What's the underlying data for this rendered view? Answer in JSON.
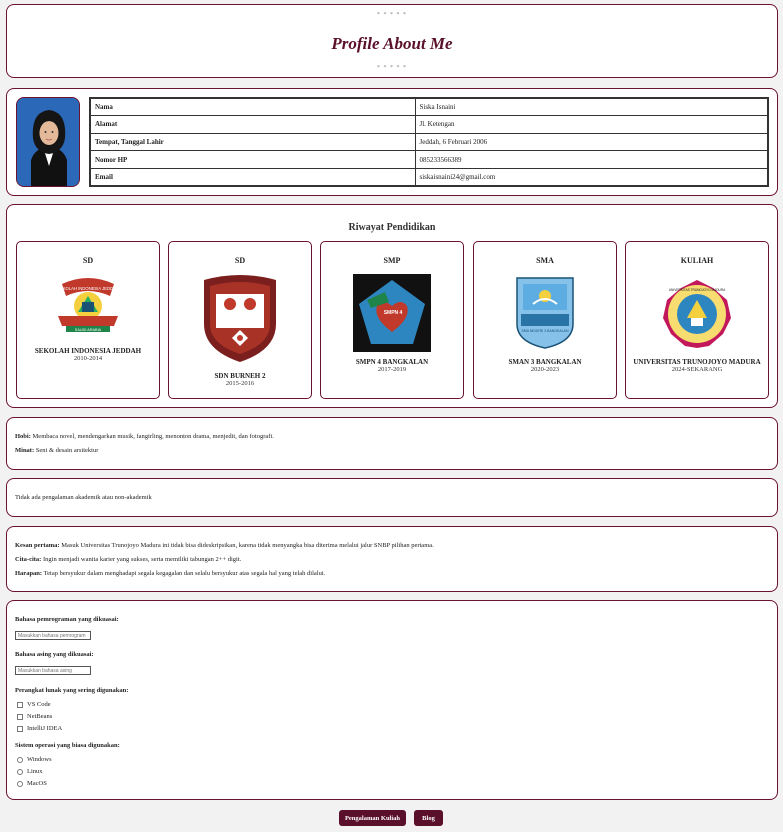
{
  "header": {
    "stars_top": "* * * * *",
    "title": "Profile About Me",
    "stars_bottom": "* * * * *"
  },
  "profile": {
    "rows": [
      {
        "key": "Nama",
        "value": "Siska Isnaini"
      },
      {
        "key": "Alamat",
        "value": "Jl. Ketengan"
      },
      {
        "key": "Tempat, Tanggal Lahir",
        "value": "Jeddah, 6 Februari 2006"
      },
      {
        "key": "Nomor HP",
        "value": "085233566389"
      },
      {
        "key": "Email",
        "value": "siskaisnaini24@gmail.com"
      }
    ]
  },
  "education": {
    "title": "Riwayat Pendidikan",
    "schools": [
      {
        "level": "SD",
        "name": "SEKOLAH INDONESIA JEDDAH",
        "years": "2010-2014",
        "logo": "sij-logo",
        "logo_text": "SEKOLAH INDONESIA JEDDAH",
        "logo_sub": "SAUDI ARABIA"
      },
      {
        "level": "SD",
        "name": "SDN BURNEH 2",
        "years": "2015-2016",
        "logo": "tut-wuri-logo"
      },
      {
        "level": "SMP",
        "name": "SMPN 4 BANGKALAN",
        "years": "2017-2019",
        "logo": "smpn4-logo",
        "logo_text": "SMPN 4"
      },
      {
        "level": "SMA",
        "name": "SMAN 3 BANGKALAN",
        "years": "2020-2023",
        "logo": "sman3-logo",
        "logo_text": "SMA NEGERI 3 BANGKALAN"
      },
      {
        "level": "KULIAH",
        "name": "UNIVERSITAS TRUNOJOYO MADURA",
        "years": "2024-SEKARANG",
        "logo": "utm-logo",
        "logo_text": "UNIVERSITAS TRUNOJOYO MADURA"
      }
    ]
  },
  "hobby": {
    "hobi_label": "Hobi:",
    "hobi_value": "Membaca novel, mendengarkan musik, fangirling, menonton drama, menjedit, dan fotografi.",
    "minat_label": "Minat:",
    "minat_value": "Seni & desain arsitektur"
  },
  "experience": {
    "text": "Tidak ada pengalaman akademik atau non-akademik"
  },
  "goals": {
    "kesan_label": "Kesan pertama:",
    "kesan_value": "Masuk Universitas Trunojoyo Madura ini tidak bisa dideskripsikan, karena tidak menyangka bisa diterima melalui jalur SNBP pilihan pertama.",
    "cita_label": "Cita-cita:",
    "cita_value": "Ingin menjadi wanita karier yang sukses, serta memiliki tabungan 2++ digit.",
    "harapan_label": "Harapan:",
    "harapan_value": "Tetap bersyukur dalam menghadapi segala kegagalan dan selalu bersyukur atas segala hal yang telah dilalui."
  },
  "form": {
    "prog_label": "Bahasa pemrograman yang dikuasai:",
    "prog_placeholder": "Masukkan bahasa pemrogram",
    "foreign_label": "Bahasa asing yang dikuasai:",
    "foreign_placeholder": "Masukkan bahasa asing",
    "software_label": "Perangkat lunak yang sering digunakan:",
    "software_options": [
      "VS Code",
      "NetBeans",
      "IntelliJ IDEA"
    ],
    "os_label": "Sistem operasi yang biasa digunakan:",
    "os_options": [
      "Windows",
      "Linux",
      "MacOS"
    ]
  },
  "nav": {
    "btn1": "Pengalaman Kuliah",
    "btn2": "Blog"
  },
  "colors": {
    "accent": "#5a0f2a",
    "border": "#6b1230"
  }
}
